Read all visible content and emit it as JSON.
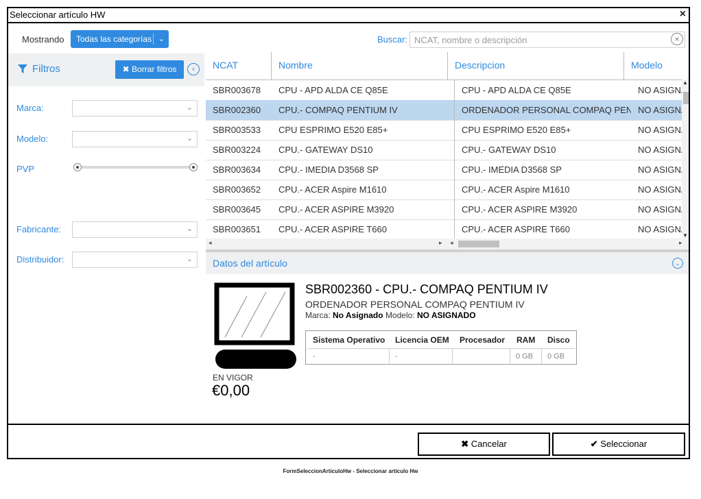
{
  "window": {
    "title": "Seleccionar artículo HW",
    "close_label": "×"
  },
  "toolbar": {
    "mostrando_label": "Mostrando",
    "category_value": "Todas las categorías",
    "buscar_label": "Buscar:",
    "search_placeholder": "NCAT, nombre o descripción"
  },
  "filters": {
    "title": "Filtros",
    "clear_button": "Borrar filtros",
    "fields": [
      {
        "label": "Marca:"
      },
      {
        "label": "Modelo:"
      },
      {
        "label": "PVP"
      },
      {
        "label": "Fabricante:"
      },
      {
        "label": "Distribuidor:"
      }
    ]
  },
  "grid": {
    "columns": [
      "NCAT",
      "Nombre",
      "Descripcion",
      "Modelo"
    ],
    "rows": [
      {
        "ncat": "SBR003678",
        "nombre": "CPU - APD ALDA CE Q85E",
        "descripcion": "CPU - APD ALDA CE Q85E",
        "modelo": "NO ASIGNADO",
        "selected": false
      },
      {
        "ncat": "SBR002360",
        "nombre": "CPU.- COMPAQ PENTIUM IV",
        "descripcion": "ORDENADOR PERSONAL COMPAQ PENTIUM...",
        "modelo": "NO ASIGNADO",
        "selected": true
      },
      {
        "ncat": "SBR003533",
        "nombre": "CPU ESPRIMO E520 E85+",
        "descripcion": "CPU ESPRIMO E520 E85+",
        "modelo": "NO ASIGNADO",
        "selected": false
      },
      {
        "ncat": "SBR003224",
        "nombre": "CPU.- GATEWAY DS10",
        "descripcion": "CPU.- GATEWAY DS10",
        "modelo": "NO ASIGNADO",
        "selected": false
      },
      {
        "ncat": "SBR003634",
        "nombre": "CPU.- IMEDIA D3568 SP",
        "descripcion": "CPU.- IMEDIA D3568 SP",
        "modelo": "NO ASIGNADO",
        "selected": false
      },
      {
        "ncat": "SBR003652",
        "nombre": "CPU.- ACER Aspire M1610",
        "descripcion": "CPU.- ACER Aspire M1610",
        "modelo": "NO ASIGNADO",
        "selected": false
      },
      {
        "ncat": "SBR003645",
        "nombre": "CPU.- ACER ASPIRE M3920",
        "descripcion": "CPU.- ACER ASPIRE M3920",
        "modelo": "NO ASIGNADO",
        "selected": false
      },
      {
        "ncat": "SBR003651",
        "nombre": "CPU.- ACER ASPIRE T660",
        "descripcion": "CPU.- ACER ASPIRE T660",
        "modelo": "NO ASIGNADO",
        "selected": false
      }
    ]
  },
  "detail": {
    "section_title": "Datos del artículo",
    "heading": "SBR002360 - CPU.- COMPAQ PENTIUM IV",
    "description": "ORDENADOR PERSONAL COMPAQ PENTIUM IV",
    "marca_label": "Marca:",
    "marca_value": "No Asignado",
    "modelo_label": "Modelo:",
    "modelo_value": "NO ASIGNADO",
    "status": "EN VIGOR",
    "price": "€0,00",
    "specs": {
      "headers": [
        "Sistema Operativo",
        "Licencia OEM",
        "Procesador",
        "RAM",
        "Disco"
      ],
      "values": [
        "-",
        "-",
        "",
        "0 GB",
        "0 GB"
      ]
    }
  },
  "footer": {
    "cancel_label": "Cancelar",
    "select_label": "Seleccionar"
  },
  "caption": "FormSeleccionArticuloHw - Seleccionar artículo Hw",
  "colors": {
    "accent": "#2f8ae0",
    "selected_row": "#bdd7ef",
    "panel_bg": "#eef0f2"
  }
}
